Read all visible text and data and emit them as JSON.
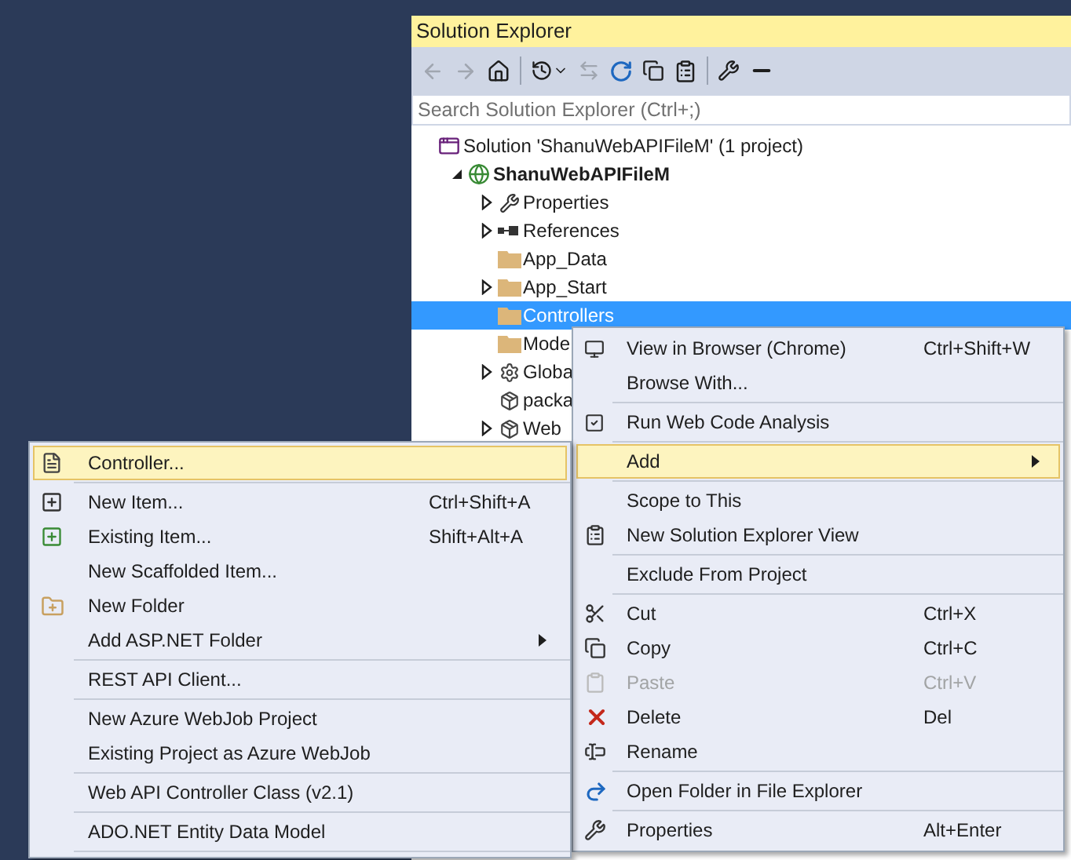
{
  "panel": {
    "title": "Solution Explorer",
    "search": {
      "placeholder": "Search Solution Explorer (Ctrl+;)"
    }
  },
  "tree": [
    {
      "kind": "solution",
      "label": "Solution 'ShanuWebAPIFileM' (1 project)",
      "selected": false,
      "children": [
        {
          "kind": "project",
          "label": "ShanuWebAPIFileM",
          "expanded": true,
          "selected": false,
          "children": [
            {
              "kind": "properties",
              "label": "Properties",
              "expanded": false,
              "selected": false
            },
            {
              "kind": "references",
              "label": "References",
              "expanded": false,
              "selected": false
            },
            {
              "kind": "folder",
              "label": "App_Data",
              "selected": false
            },
            {
              "kind": "folder",
              "label": "App_Start",
              "expanded": false,
              "selected": false
            },
            {
              "kind": "folder",
              "label": "Controllers",
              "selected": true
            },
            {
              "kind": "folder",
              "label": "Mode",
              "selected": false
            },
            {
              "kind": "config-file",
              "label": "Globa",
              "expanded": false,
              "selected": false
            },
            {
              "kind": "package-file",
              "label": "packa",
              "selected": false
            },
            {
              "kind": "package-file",
              "label": "Web",
              "expanded": false,
              "selected": false
            }
          ]
        }
      ]
    }
  ],
  "context_menu": [
    {
      "kind": "item",
      "label": "View in Browser (Chrome)",
      "shortcut": "Ctrl+Shift+W",
      "selected": false,
      "disabled": false
    },
    {
      "kind": "item",
      "label": "Browse With...",
      "selected": false,
      "disabled": false
    },
    {
      "kind": "separator"
    },
    {
      "kind": "item",
      "label": "Run Web Code Analysis",
      "selected": false,
      "disabled": false
    },
    {
      "kind": "separator"
    },
    {
      "kind": "submenu",
      "label": "Add",
      "selected": true,
      "disabled": false
    },
    {
      "kind": "separator"
    },
    {
      "kind": "item",
      "label": "Scope to This",
      "selected": false,
      "disabled": false
    },
    {
      "kind": "item",
      "label": "New Solution Explorer View",
      "selected": false,
      "disabled": false
    },
    {
      "kind": "separator"
    },
    {
      "kind": "item",
      "label": "Exclude From Project",
      "selected": false,
      "disabled": false
    },
    {
      "kind": "separator"
    },
    {
      "kind": "item",
      "label": "Cut",
      "shortcut": "Ctrl+X",
      "selected": false,
      "disabled": false
    },
    {
      "kind": "item",
      "label": "Copy",
      "shortcut": "Ctrl+C",
      "selected": false,
      "disabled": false
    },
    {
      "kind": "item",
      "label": "Paste",
      "shortcut": "Ctrl+V",
      "selected": false,
      "disabled": true
    },
    {
      "kind": "item",
      "label": "Delete",
      "shortcut": "Del",
      "selected": false,
      "disabled": false
    },
    {
      "kind": "item",
      "label": "Rename",
      "selected": false,
      "disabled": false
    },
    {
      "kind": "separator"
    },
    {
      "kind": "item",
      "label": "Open Folder in File Explorer",
      "selected": false,
      "disabled": false
    },
    {
      "kind": "separator"
    },
    {
      "kind": "item",
      "label": "Properties",
      "shortcut": "Alt+Enter",
      "selected": false,
      "disabled": false
    }
  ],
  "add_submenu": [
    {
      "kind": "item",
      "label": "Controller...",
      "selected": true,
      "disabled": false
    },
    {
      "kind": "separator"
    },
    {
      "kind": "item",
      "label": "New Item...",
      "shortcut": "Ctrl+Shift+A",
      "selected": false,
      "disabled": false
    },
    {
      "kind": "item",
      "label": "Existing Item...",
      "shortcut": "Shift+Alt+A",
      "selected": false,
      "disabled": false
    },
    {
      "kind": "item",
      "label": "New Scaffolded Item...",
      "selected": false,
      "disabled": false
    },
    {
      "kind": "item",
      "label": "New Folder",
      "selected": false,
      "disabled": false
    },
    {
      "kind": "submenu",
      "label": "Add ASP.NET Folder",
      "selected": false,
      "disabled": false
    },
    {
      "kind": "separator"
    },
    {
      "kind": "item",
      "label": "REST API Client...",
      "selected": false,
      "disabled": false
    },
    {
      "kind": "separator"
    },
    {
      "kind": "item",
      "label": "New Azure WebJob Project",
      "selected": false,
      "disabled": false
    },
    {
      "kind": "item",
      "label": "Existing Project as Azure WebJob",
      "selected": false,
      "disabled": false
    },
    {
      "kind": "separator"
    },
    {
      "kind": "item",
      "label": "Web API Controller Class (v2.1)",
      "selected": false,
      "disabled": false
    },
    {
      "kind": "separator"
    },
    {
      "kind": "item",
      "label": "ADO.NET Entity Data Model",
      "selected": false,
      "disabled": false
    },
    {
      "kind": "separator"
    }
  ]
}
